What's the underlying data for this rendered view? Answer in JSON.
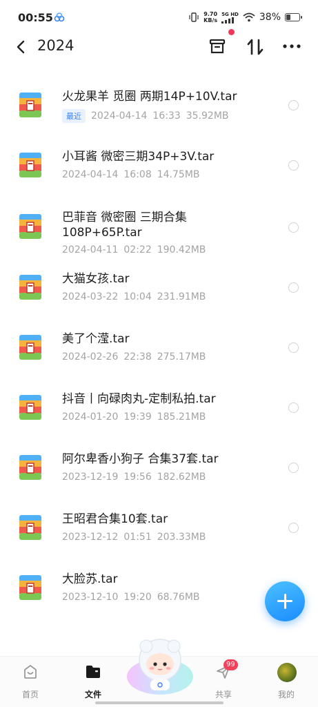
{
  "status_bar": {
    "time": "00:55",
    "net_speed_value": "9.70",
    "net_speed_unit": "KB/s",
    "network": "5G HD",
    "battery": "38%",
    "battery_level": 0.38
  },
  "header": {
    "title": "2024"
  },
  "files": [
    {
      "name": "火龙果羊 觅圈 两期14P+10V.tar",
      "badge": "最近",
      "date": "2024-04-14",
      "time": "16:33",
      "size": "35.92MB"
    },
    {
      "name": "小耳酱 微密三期34P+3V.tar",
      "badge": "",
      "date": "2024-04-14",
      "time": "16:08",
      "size": "14.75MB"
    },
    {
      "name": "巴菲音 微密圈 三期合集 108P+65P.tar",
      "badge": "",
      "date": "2024-04-11",
      "time": "02:22",
      "size": "190.42MB"
    },
    {
      "name": "大猫女孩.tar",
      "badge": "",
      "date": "2024-03-22",
      "time": "10:04",
      "size": "231.91MB"
    },
    {
      "name": "美了个滢.tar",
      "badge": "",
      "date": "2024-02-26",
      "time": "22:38",
      "size": "275.17MB"
    },
    {
      "name": "抖音丨向碌肉丸-定制私拍.tar",
      "badge": "",
      "date": "2024-01-20",
      "time": "19:39",
      "size": "185.21MB"
    },
    {
      "name": "阿尔卑香小狗子 合集37套.tar",
      "badge": "",
      "date": "2023-12-19",
      "time": "19:56",
      "size": "182.62MB"
    },
    {
      "name": "王昭君合集10套.tar",
      "badge": "",
      "date": "2023-12-12",
      "time": "01:51",
      "size": "203.33MB"
    },
    {
      "name": "大脸苏.tar",
      "badge": "",
      "date": "2023-12-10",
      "time": "19:20",
      "size": "68.76MB"
    }
  ],
  "bottom_nav": {
    "items": [
      {
        "label": "首页",
        "icon": "home-icon"
      },
      {
        "label": "文件",
        "icon": "folder-icon",
        "active": true
      },
      {
        "label": "共享",
        "icon": "send-icon",
        "badge": "99"
      },
      {
        "label": "我的",
        "icon": "avatar"
      }
    ]
  },
  "colors": {
    "accent": "#1a8cff",
    "badge_red": "#f2415a",
    "recent_badge_bg": "#e7f1ff",
    "recent_badge_text": "#3a82f0"
  }
}
